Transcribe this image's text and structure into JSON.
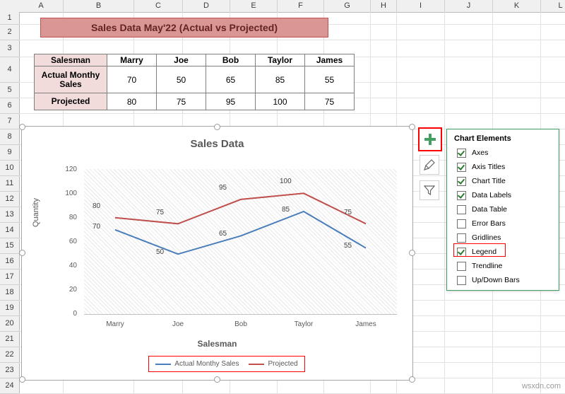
{
  "spreadsheet": {
    "columns": [
      "A",
      "B",
      "C",
      "D",
      "E",
      "F",
      "G",
      "H",
      "I",
      "J",
      "K",
      "L"
    ],
    "rows": [
      "1",
      "2",
      "3",
      "4",
      "5",
      "6",
      "7",
      "8",
      "9",
      "10",
      "11",
      "12",
      "13",
      "14",
      "15",
      "16",
      "17",
      "18",
      "19",
      "20",
      "21",
      "22",
      "23",
      "24"
    ]
  },
  "title_banner": "Sales Data May'22 (Actual vs Projected)",
  "data_table": {
    "header": [
      "Salesman",
      "Marry",
      "Joe",
      "Bob",
      "Taylor",
      "James"
    ],
    "rows": [
      {
        "label": "Actual Monthy Sales",
        "values": [
          "70",
          "50",
          "65",
          "85",
          "55"
        ]
      },
      {
        "label": "Projected",
        "values": [
          "80",
          "75",
          "95",
          "100",
          "75"
        ]
      }
    ]
  },
  "chart": {
    "title": "Sales Data",
    "xlabel": "Salesman",
    "ylabel": "Quantity",
    "legend": [
      {
        "name": "Actual Monthy Sales",
        "color": "#4a7ebb"
      },
      {
        "name": "Projected",
        "color": "#c0504d"
      }
    ]
  },
  "chart_data": {
    "type": "line",
    "title": "Sales Data",
    "xlabel": "Salesman",
    "ylabel": "Quantity",
    "categories": [
      "Marry",
      "Joe",
      "Bob",
      "Taylor",
      "James"
    ],
    "ylim": [
      0,
      120
    ],
    "yticks": [
      "0",
      "20",
      "40",
      "60",
      "80",
      "100",
      "120"
    ],
    "grid": false,
    "legend_position": "bottom",
    "series": [
      {
        "name": "Actual Monthy Sales",
        "color": "#4a7ebb",
        "values": [
          70,
          50,
          65,
          85,
          55
        ]
      },
      {
        "name": "Projected",
        "color": "#c0504d",
        "values": [
          80,
          75,
          95,
          100,
          75
        ]
      }
    ]
  },
  "chart_elements_panel": {
    "header": "Chart Elements",
    "items": [
      {
        "label": "Axes",
        "checked": true
      },
      {
        "label": "Axis Titles",
        "checked": true
      },
      {
        "label": "Chart Title",
        "checked": true
      },
      {
        "label": "Data Labels",
        "checked": true
      },
      {
        "label": "Data Table",
        "checked": false
      },
      {
        "label": "Error Bars",
        "checked": false
      },
      {
        "label": "Gridlines",
        "checked": false
      },
      {
        "label": "Legend",
        "checked": true
      },
      {
        "label": "Trendline",
        "checked": false
      },
      {
        "label": "Up/Down Bars",
        "checked": false
      }
    ]
  },
  "side_buttons": {
    "add_element": "+",
    "styles": "brush-icon",
    "filter": "funnel-icon"
  },
  "watermark": "wsxdn.com"
}
